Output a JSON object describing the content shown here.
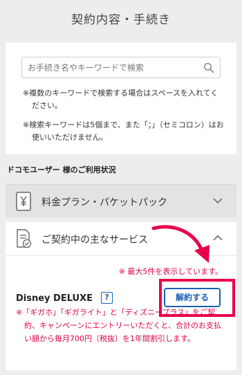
{
  "page": {
    "title": "契約内容・手続き"
  },
  "search": {
    "placeholder": "お手続き名やキーワードで検索",
    "notes": [
      "※複数のキーワードで検索する場合はスペースを入れてください。",
      "※検索キーワードは5個まで、また「；」（セミコロン）はお使いいただけません。"
    ]
  },
  "usage": {
    "heading": "ドコモユーザー 様のご利用状況"
  },
  "accordions": [
    {
      "label": "料金プラン・パケットパック",
      "expanded": false
    },
    {
      "label": "ご契約中の主なサービス",
      "expanded": true
    }
  ],
  "services": {
    "max_note": "※ 最大5件を表示しています。",
    "items": [
      {
        "name": "Disney DELUXE",
        "help": "?",
        "action_label": "解約する",
        "note": "※「ギガホ」「ギガライト」と「ディズニープラス」をご契約、キャンペーンにエントリーいただくと、合計のお支払い額から毎月700円（税抜）を1年間割引します。"
      }
    ]
  },
  "colors": {
    "accent": "#e8004a",
    "link": "#1a5fb4",
    "background": "#ededed"
  }
}
